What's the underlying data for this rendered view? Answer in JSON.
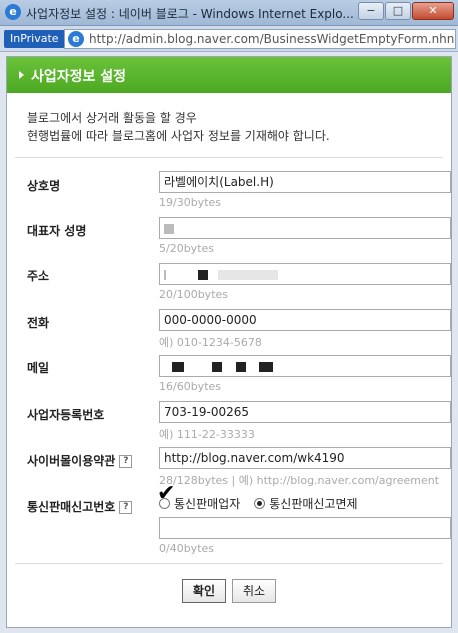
{
  "window": {
    "title": "사업자정보 설정 : 네이버 블로그 - Windows Internet Explo...",
    "minimize": "−",
    "maximize": "□",
    "close": "✕"
  },
  "addressbar": {
    "inprivate": "InPrivate",
    "url": "http://admin.blog.naver.com/BusinessWidgetEmptyForm.nhn?blog..."
  },
  "header": {
    "title": "사업자정보 설정"
  },
  "notice": {
    "line1": "블로그에서 상거래 활동을 할 경우",
    "line2": "현행법률에 따라 블로그홈에 사업자 정보를 기재해야 합니다."
  },
  "fields": {
    "company": {
      "label": "상호명",
      "value": "라벨에이치(Label.H)",
      "hint": "19/30bytes"
    },
    "ceo": {
      "label": "대표자 성명",
      "value": "",
      "hint": "5/20bytes"
    },
    "address": {
      "label": "주소",
      "value": "",
      "hint": "20/100bytes"
    },
    "phone": {
      "label": "전화",
      "value": "000-0000-0000",
      "hint": "예) 010-1234-5678"
    },
    "email": {
      "label": "메일",
      "value": "",
      "hint": "16/60bytes"
    },
    "bizno": {
      "label": "사업자등록번호",
      "value": "703-19-00265",
      "hint": "예) 111-22-33333"
    },
    "terms": {
      "label": "사이버몰이용약관",
      "value": "http://blog.naver.com/wk4190",
      "hint": "28/128bytes | 예) http://blog.naver.com/agreement"
    },
    "ecommerce": {
      "label": "통신판매신고번호",
      "option1": "통신판매업자",
      "option2": "통신판매신고면제",
      "value": "",
      "hint": "0/40bytes"
    }
  },
  "help_icon": "?",
  "annotation_mark": "✔",
  "buttons": {
    "confirm": "확인",
    "cancel": "취소"
  }
}
